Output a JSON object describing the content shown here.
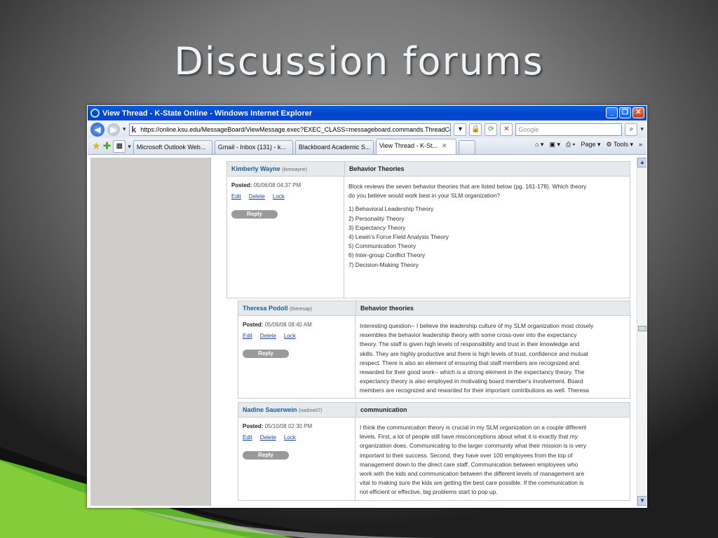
{
  "slide": {
    "title": "Discussion forums"
  },
  "window": {
    "title": "View Thread - K-State Online - Windows Internet Explorer",
    "address": "https://online.ksu.edu/MessageBoard/ViewMessage.exec?EXEC_CLASS=messageboard.commands.ThreadCommandst",
    "search_placeholder": "Google",
    "tabs": [
      {
        "label": "Microsoft Outlook Web..."
      },
      {
        "label": "Gmail - Inbox (131) - k..."
      },
      {
        "label": "Blackboard Academic S..."
      },
      {
        "label": "View Thread - K-St..."
      }
    ],
    "commands": {
      "page": "Page",
      "tools": "Tools"
    }
  },
  "posts": [
    {
      "author": "Kimberly Wayne",
      "username": "(kimwayne)",
      "subject": "Behavior Theories",
      "posted_label": "Posted:",
      "posted_date": "05/06/08 04:37 PM",
      "edit": "Edit",
      "delete": "Delete",
      "lock": "Lock",
      "reply": "Reply",
      "intro": [
        "Block reviews the seven behavior theories that are listed below (pg. 161-178).  Which theory",
        "do you believe would work best in your SLM organization?"
      ],
      "list": [
        "1) Behavioral Leadership Theory",
        "2) Personality Theory",
        "3) Expectancy Theory",
        "4) Lewin's Force Field Analysis Theory",
        "5) Communication Theory",
        "6) Inter-group Conflict Theory",
        "7) Decision-Making Theory"
      ]
    },
    {
      "author": "Theresa Podoll",
      "username": "(theresap)",
      "subject": "Behavior theories",
      "posted_label": "Posted:",
      "posted_date": "05/09/08 08:40 AM",
      "edit": "Edit",
      "delete": "Delete",
      "lock": "Lock",
      "reply": "Reply",
      "lines": [
        "Interesting question-- I believe the leadership culture of my SLM organization most closely",
        "resembles the behavior leadership theory with some cross-over into the expectancy",
        "theory. The staff is given high levels of responsibility and trust in their knowledge and",
        "skills. They are highly productive and there is high levels of trust, confidence and mutual",
        "respect. There is also an element of ensuring that staff members are recognized and",
        "rewarded for their good work-- which is a strong element in the expectancy theory. The",
        "expectancy theory is also employed in motivating board member's involvement. Board",
        "members are recognized and rewarded for their important contributions as well. Theresa"
      ]
    },
    {
      "author": "Nadine Sauerwein",
      "username": "(nadine07)",
      "subject": "communication",
      "posted_label": "Posted:",
      "posted_date": "05/10/08 02:30 PM",
      "edit": "Edit",
      "delete": "Delete",
      "lock": "Lock",
      "reply": "Reply",
      "lines": [
        " I think the communication theory is crucial in my SLM organization on a couple different",
        "levels. First, a lot of people still have misconceptions about what it is exactly that my",
        "organization does. Communicating to the larger community what their mission is is very",
        "important to their success. Second, they have over 100 employees from the top of",
        "management down to the direct care staff. Communication between employees who",
        "work with the kids and communication between the different levels of management are",
        "vital to making sure the kids are getting the best care possible. If the communication is",
        "not efficient or effective, big problems start to pop up."
      ]
    }
  ]
}
